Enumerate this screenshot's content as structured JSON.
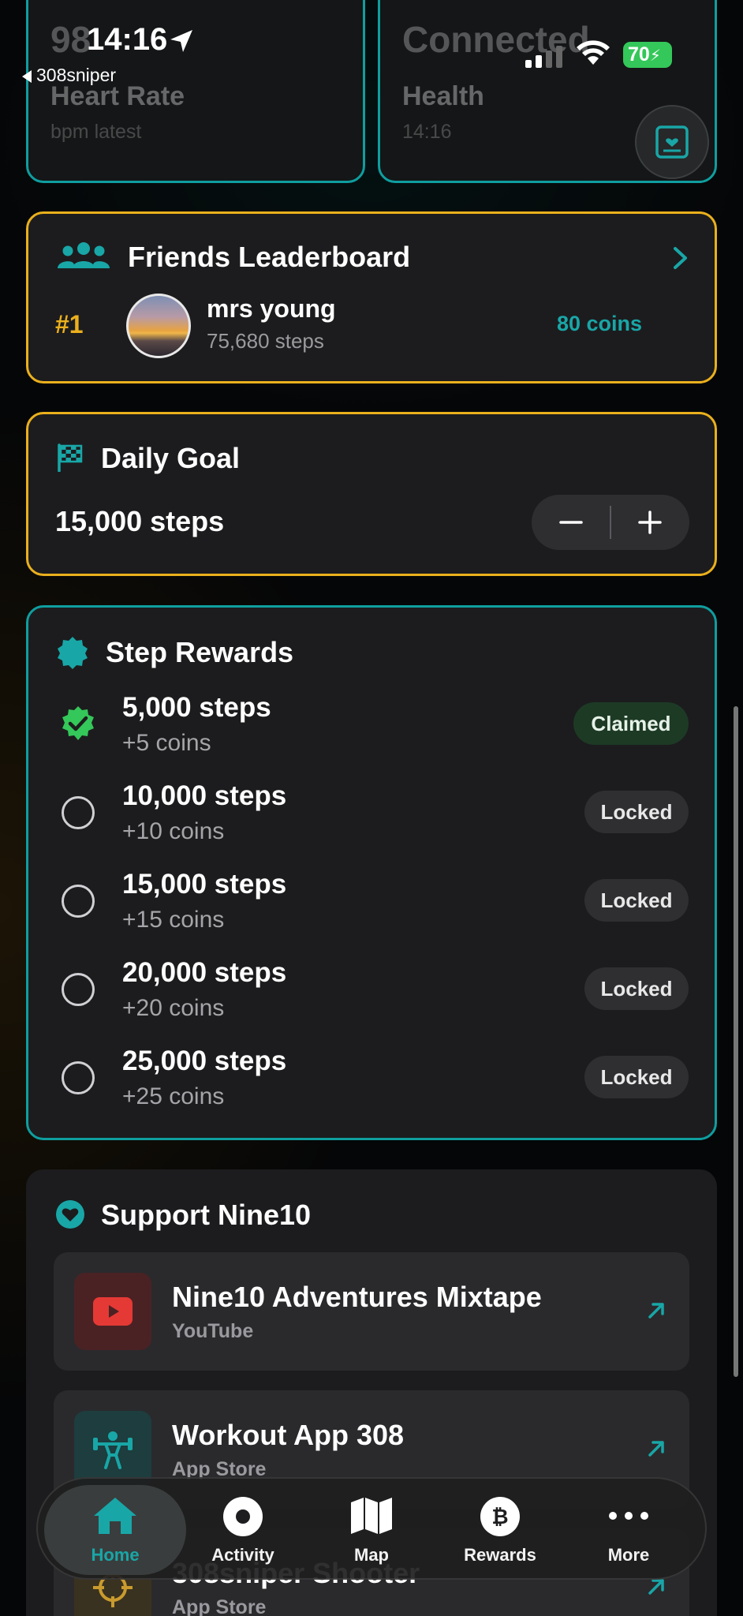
{
  "status_bar": {
    "time": "14:16",
    "back_label": "308sniper",
    "battery": "70"
  },
  "top_cards": [
    {
      "value": "98",
      "title": "Heart Rate",
      "sub": "bpm latest"
    },
    {
      "value": "Connected",
      "title": "Health",
      "sub": "14:16"
    }
  ],
  "leaderboard": {
    "title": "Friends Leaderboard",
    "rank": "#1",
    "name": "mrs young",
    "steps": "75,680 steps",
    "coins": "80 coins"
  },
  "daily_goal": {
    "title": "Daily Goal",
    "value": "15,000 steps"
  },
  "step_rewards": {
    "title": "Step Rewards",
    "items": [
      {
        "steps": "5,000 steps",
        "coins": "+5 coins",
        "status": "Claimed"
      },
      {
        "steps": "10,000 steps",
        "coins": "+10 coins",
        "status": "Locked"
      },
      {
        "steps": "15,000 steps",
        "coins": "+15 coins",
        "status": "Locked"
      },
      {
        "steps": "20,000 steps",
        "coins": "+20 coins",
        "status": "Locked"
      },
      {
        "steps": "25,000 steps",
        "coins": "+25 coins",
        "status": "Locked"
      }
    ]
  },
  "support": {
    "title": "Support Nine10",
    "links": [
      {
        "title": "Nine10 Adventures Mixtape",
        "sub": "YouTube",
        "icon": "youtube-icon"
      },
      {
        "title": "Workout App 308",
        "sub": "App Store",
        "icon": "weightlifter-icon"
      },
      {
        "title": "308sniper Shooter",
        "sub": "App Store",
        "icon": "crosshair-icon"
      }
    ]
  },
  "tabs": [
    {
      "label": "Home",
      "icon": "home-icon"
    },
    {
      "label": "Activity",
      "icon": "activity-icon"
    },
    {
      "label": "Map",
      "icon": "map-icon"
    },
    {
      "label": "Rewards",
      "icon": "bitcoin-icon"
    },
    {
      "label": "More",
      "icon": "more-icon"
    }
  ],
  "colors": {
    "teal": "#0f9e9f",
    "gold": "#eab01d",
    "claimed_green": "#34c759"
  }
}
